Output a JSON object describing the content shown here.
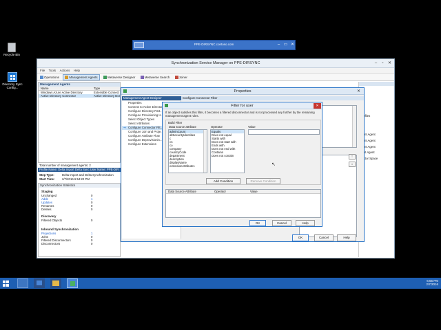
{
  "rdp": {
    "title": "PPE-DIRSYNC.contoso.com"
  },
  "desktop": {
    "icons": [
      {
        "label": "Recycle Bin",
        "icon": "recycle-bin-icon"
      },
      {
        "label": "Directory Sync Config...",
        "icon": "windows-logo-icon"
      }
    ]
  },
  "app": {
    "title": "Synchronization Service Manager on PPE-DIRSYNC",
    "menu": [
      "File",
      "Tools",
      "Actions",
      "Help"
    ],
    "toolbar": [
      {
        "label": "Operations",
        "icon": "operations-icon"
      },
      {
        "label": "Management Agents",
        "icon": "management-agents-icon",
        "active": true
      },
      {
        "label": "Metaverse Designer",
        "icon": "metaverse-designer-icon"
      },
      {
        "label": "Metaverse Search",
        "icon": "metaverse-search-icon"
      },
      {
        "label": "Joiner",
        "icon": "joiner-icon"
      }
    ],
    "ma_header": "Management Agents",
    "ma_columns": [
      "Name",
      "Type"
    ],
    "ma_rows": [
      {
        "name": "Windows Azure Active Directory",
        "type": "Extensible Connect"
      },
      {
        "name": "Active Directory Connector",
        "type": "Active Directory Dom",
        "selected": true
      }
    ],
    "total": "Total number of management agents: 2",
    "profile_bar": "Profile Name: Delta Import Delta Sync  User Name: PPE-DIR",
    "step_type_label": "Step Type:",
    "step_type": "Delta Import and Delta Synchronization",
    "start_time_label": "Start Time:",
    "start_time": "2/7/2016 6:54:22 PM",
    "stats_header": "Synchronization Statistics",
    "staging_title": "Staging",
    "staging": [
      {
        "label": "Unchanged",
        "value": "0",
        "link": false
      },
      {
        "label": "Adds",
        "value": "1",
        "link": true
      },
      {
        "label": "Updates",
        "value": "0",
        "link": true
      },
      {
        "label": "Renames",
        "value": "0",
        "link": false
      },
      {
        "label": "Deletes",
        "value": "0",
        "link": false
      }
    ],
    "discovery_title": "Discovery",
    "discovery": [
      {
        "label": "Filtered Objects",
        "value": "0"
      }
    ],
    "inbound_title": "Inbound Synchronization",
    "inbound": [
      {
        "label": "Projections",
        "value": "1",
        "link": true
      },
      {
        "label": "Joins",
        "value": "0",
        "link": false
      },
      {
        "label": "Filtered Disconnectors",
        "value": "0",
        "link": false
      },
      {
        "label": "Disconnectors",
        "value": "0",
        "link": false
      }
    ],
    "right_actions": [
      "Profiles",
      "ment Agent",
      "ment Agent",
      "ment Agent",
      "nent Agent",
      "nector Space"
    ]
  },
  "properties": {
    "title": "Properties",
    "left_header": "Management Agent Designer",
    "right_header": "Configure Connector Filter",
    "nav": [
      "Properties",
      "Connect to Active Directory...",
      "Configure Directory Part...",
      "Configure Provisioning H...",
      "Select Object Types",
      "Select Attributes",
      "Configure Connector Filt...",
      "Configure Join and Proje...",
      "Configure Attribute Flow",
      "Configure Deprovisionin...",
      "Configure Extensions"
    ],
    "selected_nav": 6,
    "ok": "OK",
    "cancel": "Cancel",
    "help": "Help"
  },
  "filter": {
    "title": "Filter for user",
    "description": "If an object satisfies this filter, it becomes a filtered disconnector and is not processed any further by the remaining management agent rules.",
    "build_label": "Build Filter",
    "attr_col": "Data source attribute",
    "op_col": "Operator",
    "val_col": "Value",
    "attributes": [
      "adminCount",
      "altSecurityIdentities",
      "c",
      "cn",
      "co",
      "company",
      "countryCode",
      "department",
      "description",
      "displayName",
      "extensionAttribute1"
    ],
    "operators": [
      "Equals",
      "Does not equal",
      "Starts with",
      "Does not start with",
      "Ends with",
      "Does not end with",
      "Contains",
      "Does not contain"
    ],
    "value": "",
    "add_condition": "Add Condition",
    "remove_condition": "Remove Condition",
    "grid_cols": [
      "Data Source Attribute",
      "Operator",
      "Value"
    ],
    "ok": "OK",
    "cancel": "Cancel",
    "help": "Help"
  },
  "taskbar": {
    "apps": [
      {
        "icon": "server-manager-icon"
      },
      {
        "icon": "powershell-icon"
      },
      {
        "icon": "file-explorer-icon"
      },
      {
        "icon": "sync-service-icon"
      }
    ],
    "time": "6:55 PM",
    "date": "2/7/2016"
  }
}
